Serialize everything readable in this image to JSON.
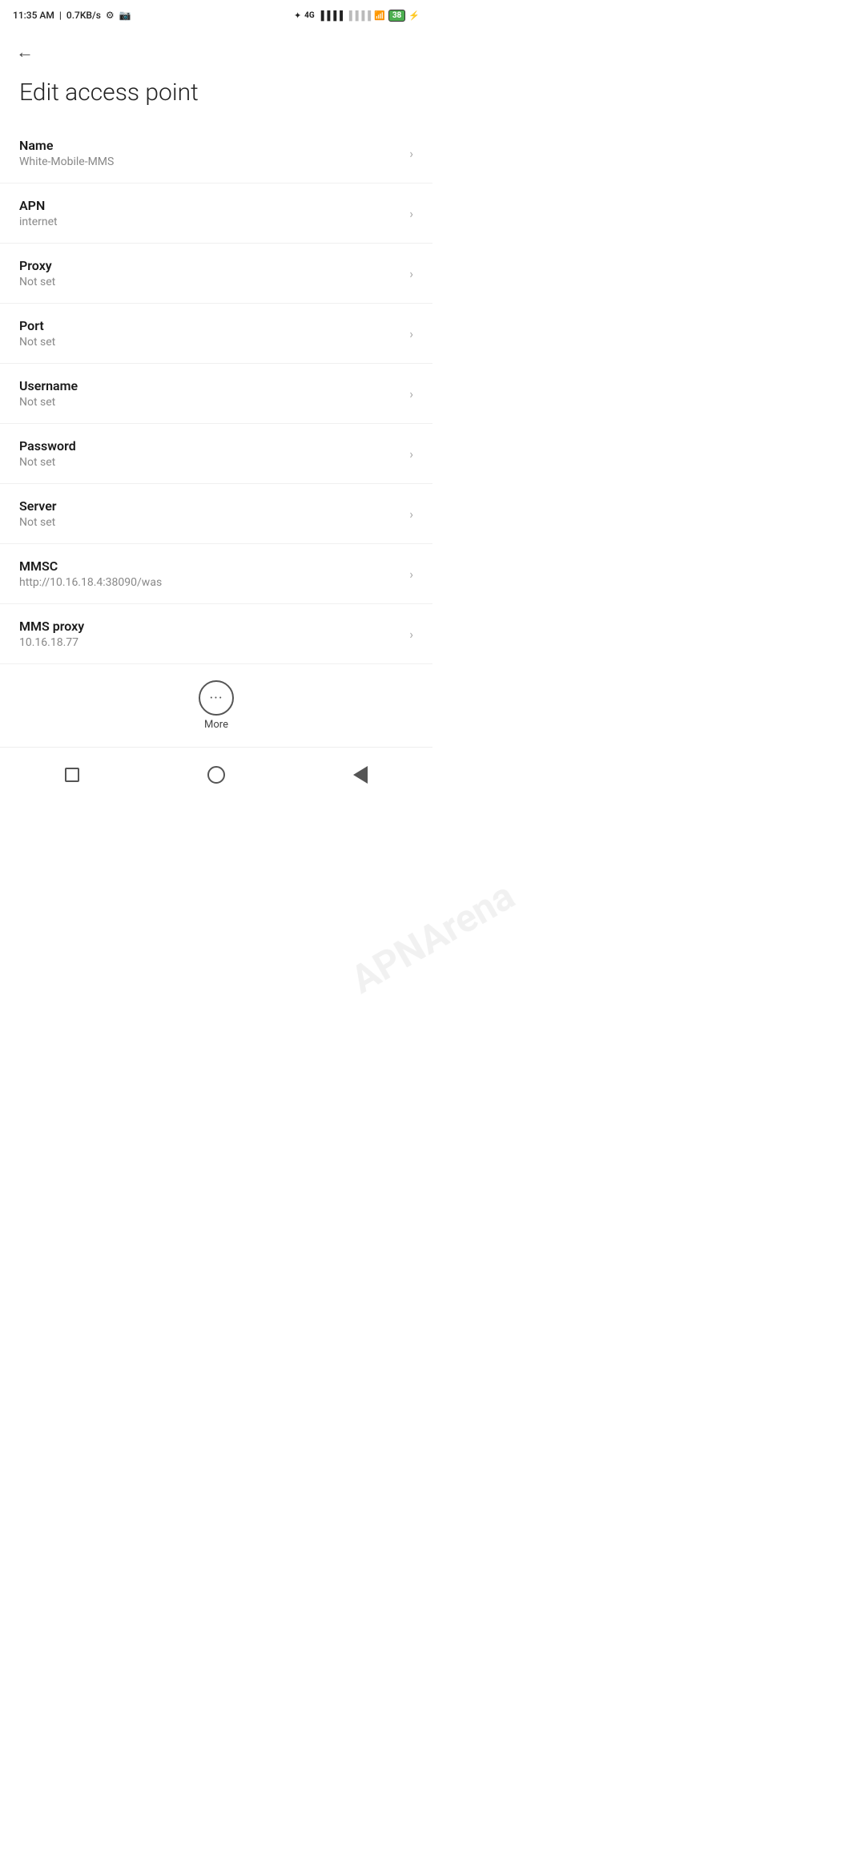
{
  "statusBar": {
    "time": "11:35 AM",
    "speed": "0.7KB/s",
    "battery": "38"
  },
  "header": {
    "title": "Edit access point"
  },
  "settings": [
    {
      "label": "Name",
      "value": "White-Mobile-MMS"
    },
    {
      "label": "APN",
      "value": "internet"
    },
    {
      "label": "Proxy",
      "value": "Not set"
    },
    {
      "label": "Port",
      "value": "Not set"
    },
    {
      "label": "Username",
      "value": "Not set"
    },
    {
      "label": "Password",
      "value": "Not set"
    },
    {
      "label": "Server",
      "value": "Not set"
    },
    {
      "label": "MMSC",
      "value": "http://10.16.18.4:38090/was"
    },
    {
      "label": "MMS proxy",
      "value": "10.16.18.77"
    }
  ],
  "more": {
    "label": "More"
  },
  "watermark": "APNArena"
}
